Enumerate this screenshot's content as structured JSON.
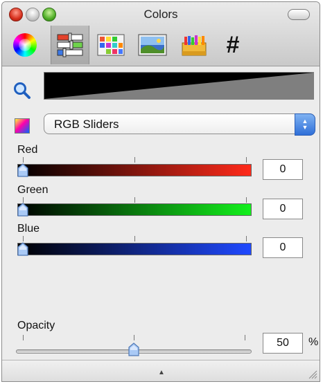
{
  "window": {
    "title": "Colors"
  },
  "toolbar": {
    "tools": [
      {
        "icon": "color-wheel-icon",
        "selected": false
      },
      {
        "icon": "color-sliders-icon",
        "selected": true
      },
      {
        "icon": "color-palettes-icon",
        "selected": false
      },
      {
        "icon": "image-palette-icon",
        "selected": false
      },
      {
        "icon": "crayons-icon",
        "selected": false
      },
      {
        "icon": "hex-hash-icon",
        "label": "#",
        "selected": false
      }
    ]
  },
  "picker": {
    "mode_label": "RGB Sliders",
    "sliders": [
      {
        "label": "Red",
        "value": "0",
        "color": "#ff2a1a"
      },
      {
        "label": "Green",
        "value": "0",
        "color": "#13f01c"
      },
      {
        "label": "Blue",
        "value": "0",
        "color": "#1f49ff"
      }
    ],
    "opacity": {
      "label": "Opacity",
      "value": "50",
      "unit": "%",
      "level": 0.5
    }
  }
}
